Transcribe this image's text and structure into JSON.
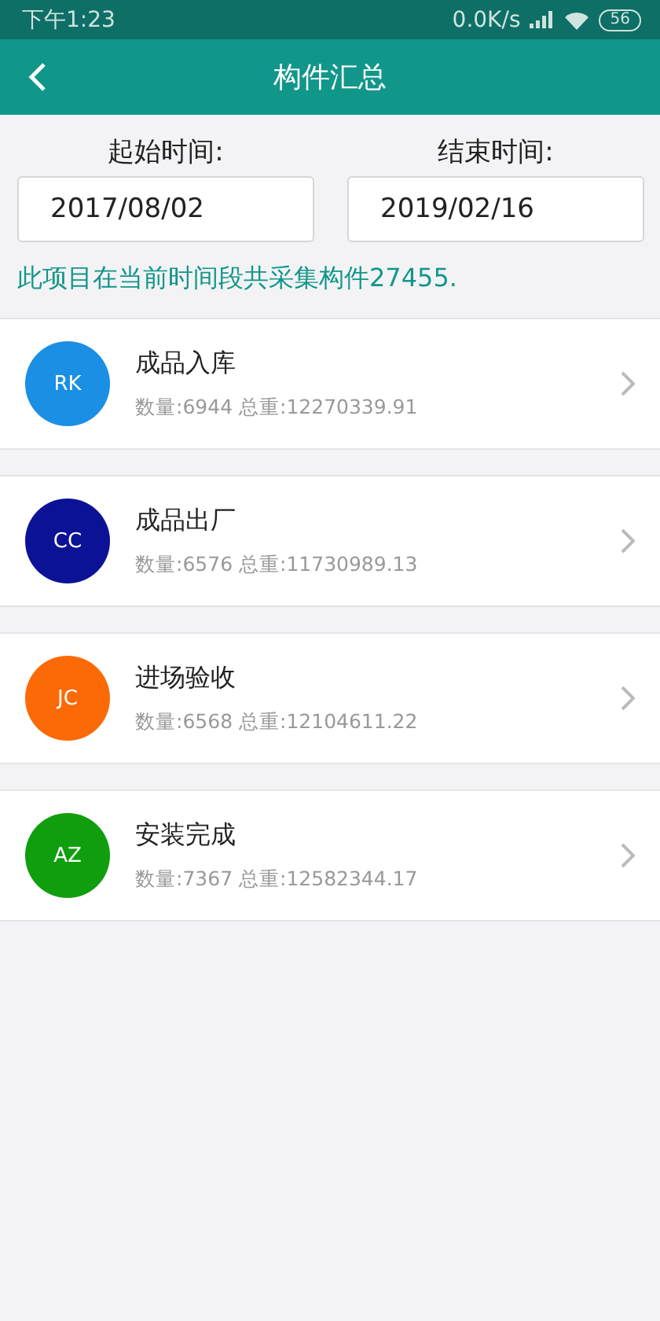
{
  "status_bar": {
    "time": "下午1:23",
    "speed": "0.0K/s",
    "battery": "56"
  },
  "app_bar": {
    "title": "构件汇总"
  },
  "date_range": [
    {
      "label": "起始时间:",
      "value": "2017/08/02"
    },
    {
      "label": "结束时间:",
      "value": "2019/02/16"
    }
  ],
  "summary": "此项目在当前时间段共采集构件27455.",
  "items": [
    {
      "badge": "RK",
      "color": "#1a8fe3",
      "title": "成品入库",
      "detail": "数量:6944 总重:12270339.91"
    },
    {
      "badge": "CC",
      "color": "#0c1296",
      "title": "成品出厂",
      "detail": "数量:6576 总重:11730989.13"
    },
    {
      "badge": "JC",
      "color": "#fc6a08",
      "title": "进场验收",
      "detail": "数量:6568 总重:12104611.22"
    },
    {
      "badge": "AZ",
      "color": "#109e0e",
      "title": "安装完成",
      "detail": "数量:7367 总重:12582344.17"
    }
  ]
}
